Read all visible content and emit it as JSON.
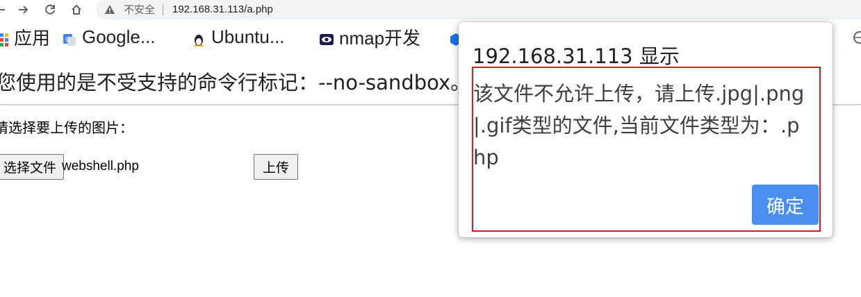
{
  "browser": {
    "insecure_label": "不安全",
    "url": "192.168.31.113/a.php",
    "bookmarks": [
      {
        "label": "应用",
        "icon": "apps-grid-icon"
      },
      {
        "label": "Google...",
        "icon": "google-translate-icon"
      },
      {
        "label": "Ubuntu...",
        "icon": "tux-penguin-icon"
      },
      {
        "label": "nmap开发",
        "icon": "nmap-eye-icon"
      }
    ]
  },
  "infobar": {
    "message": "您使用的是不受支持的命令行标记：--no-sandbox。"
  },
  "page": {
    "prompt": "请选择要上传的图片：",
    "choose_file_label": "选择文件",
    "file_name": "webshell.php",
    "upload_label": "上传"
  },
  "dialog": {
    "title": "192.168.31.113 显示",
    "message": "该文件不允许上传，请上传.jpg|.png|.gif类型的文件,当前文件类型为：.php",
    "ok_label": "确定",
    "ok_color": "#4a8ff0",
    "highlight_color": "#e8161c"
  }
}
